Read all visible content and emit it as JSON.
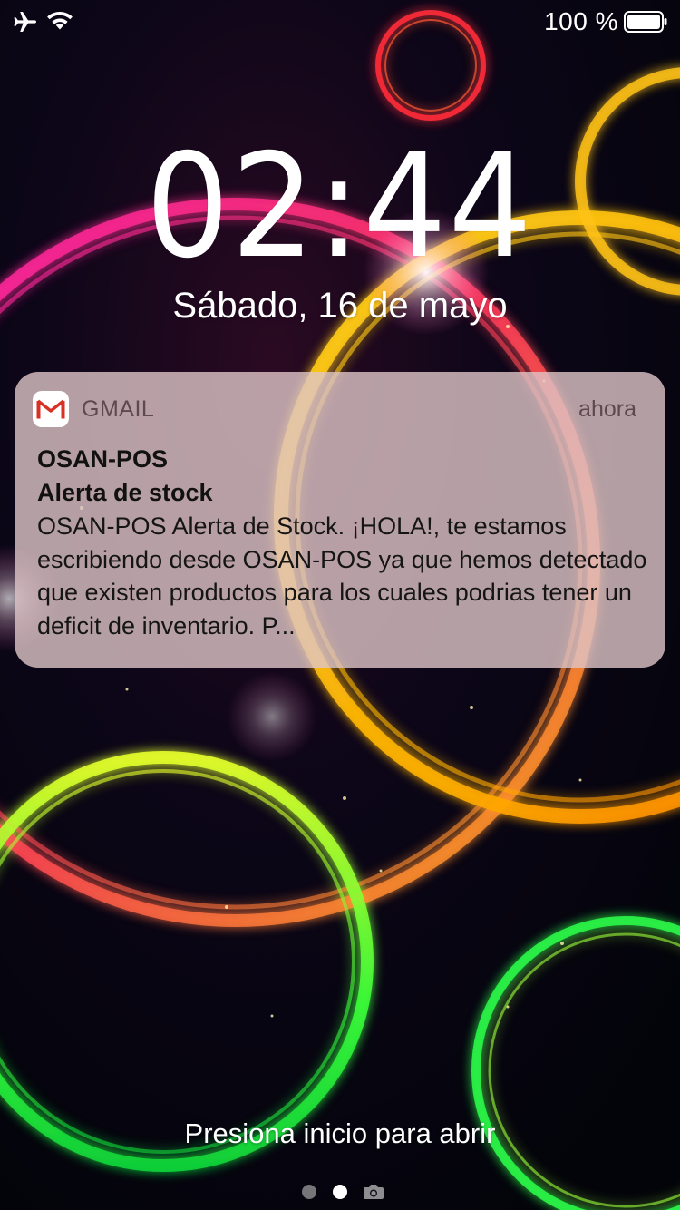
{
  "status_bar": {
    "airplane_icon": "airplane-icon",
    "wifi_icon": "wifi-icon",
    "battery_percent": "100 %",
    "battery_icon": "battery-full-icon"
  },
  "lock_screen": {
    "time": "02:44",
    "date": "Sábado, 16 de mayo",
    "unlock_hint": "Presiona inicio para abrir",
    "page_indicator": {
      "pages": 2,
      "current": 2,
      "camera_icon": "camera-icon"
    }
  },
  "notification": {
    "app_icon": "gmail-icon",
    "app_name": "GMAIL",
    "time": "ahora",
    "title": "OSAN-POS",
    "subtitle": "Alerta de stock",
    "body": "OSAN-POS Alerta de Stock. ¡HOLA!, te estamos escribiendo desde OSAN-POS ya que hemos detectado que existen productos para los cuales podrias tener un deficit de inventario. P..."
  },
  "colors": {
    "notification_bg": "#DEC6C8",
    "gmail_red": "#D93025",
    "wallpaper_base": "#05030D"
  }
}
